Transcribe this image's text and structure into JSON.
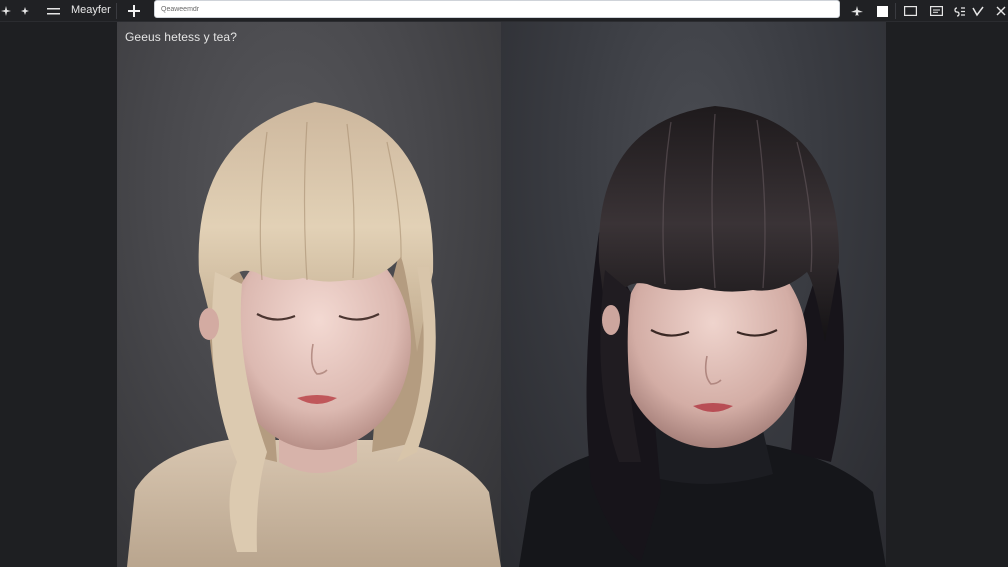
{
  "toolbar": {
    "app_name": "Meayfer",
    "search_placeholder": "Qeaweemdr",
    "left_icons": [
      "compass-icon",
      "sparkle-icon",
      "menu-icon"
    ],
    "right_icons": [
      "plane-icon",
      "square-icon",
      "window-icon",
      "gallery-icon",
      "settings-icon",
      "check-icon",
      "close-icon"
    ]
  },
  "viewer": {
    "caption": "Geeus hetess y tea?",
    "images": [
      {
        "subject": "girl with blonde bob hair, beige sweater, eyes closed"
      },
      {
        "subject": "girl with black shoulder-length hair, black turtleneck, eyes closed"
      }
    ]
  },
  "colors": {
    "toolbar_bg": "#202124",
    "page_bg": "#1d1e21",
    "search_bg": "#ffffff"
  }
}
